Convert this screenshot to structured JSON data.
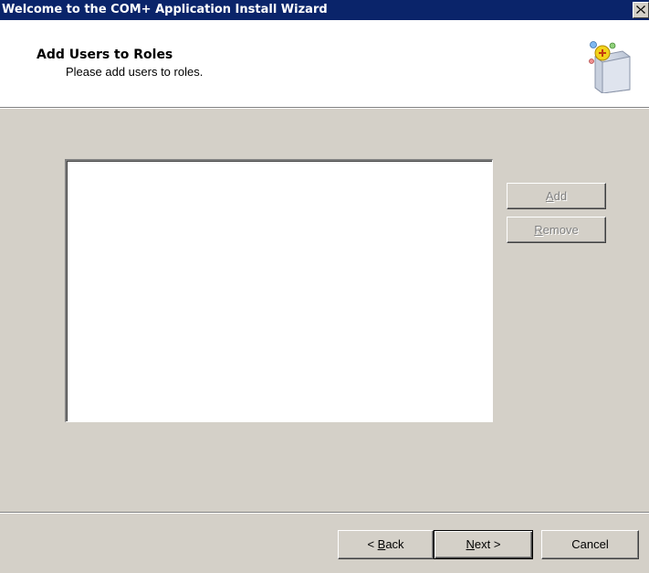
{
  "window": {
    "title": "Welcome to the COM+ Application Install Wizard",
    "close_glyph": "close-icon"
  },
  "header": {
    "title": "Add Users to Roles",
    "subtitle": "Please add users to roles.",
    "icon": "wizard-box-icon"
  },
  "list": {
    "items": []
  },
  "buttons": {
    "add": {
      "mnemonic": "A",
      "rest": "dd",
      "enabled": false
    },
    "remove": {
      "mnemonic": "R",
      "rest": "emove",
      "enabled": false
    }
  },
  "footer": {
    "back": {
      "pre": "< ",
      "mnemonic": "B",
      "rest": "ack"
    },
    "next": {
      "mnemonic": "N",
      "rest": "ext >"
    },
    "cancel": "Cancel"
  },
  "colors": {
    "titlebar": "#0a246a",
    "dialog": "#d4d0c8",
    "disabled_text": "#808080"
  }
}
